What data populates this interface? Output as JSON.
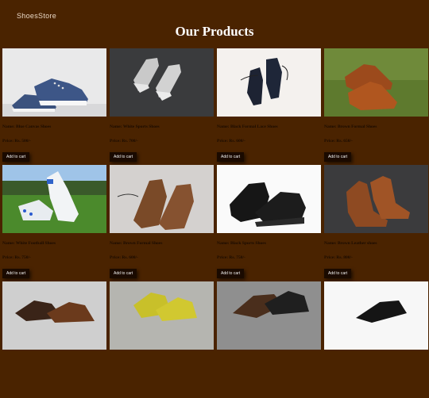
{
  "header": {
    "brand": "ShoesStore",
    "title": "Our Products"
  },
  "products": [
    {
      "name": "Name: Blue Canvas Shoes",
      "price": "Price: Rs. 500/-",
      "cart": "Add to cart"
    },
    {
      "name": "Name: White Sports Shoes",
      "price": "Price: Rs. 700/-",
      "cart": "Add to cart"
    },
    {
      "name": "Name: Black Formal Lace Shoes",
      "price": "Price: Rs. 600/-",
      "cart": "Add to cart"
    },
    {
      "name": "Name: Brown Formal Shoes",
      "price": "Price: Rs. 650/-",
      "cart": "Add to cart"
    },
    {
      "name": "Name: White Football Shoes",
      "price": "Price: Rs. 750/-",
      "cart": "Add to cart"
    },
    {
      "name": "Name: Brown Formal Shoes",
      "price": "Price: Rs. 600/-",
      "cart": "Add to cart"
    },
    {
      "name": "Name: Black Sports Shoes",
      "price": "Price: Rs. 750/-",
      "cart": "Add to cart"
    },
    {
      "name": "Name: Brown Leather shoes",
      "price": "Price: Rs. 800/-",
      "cart": "Add to cart"
    }
  ]
}
